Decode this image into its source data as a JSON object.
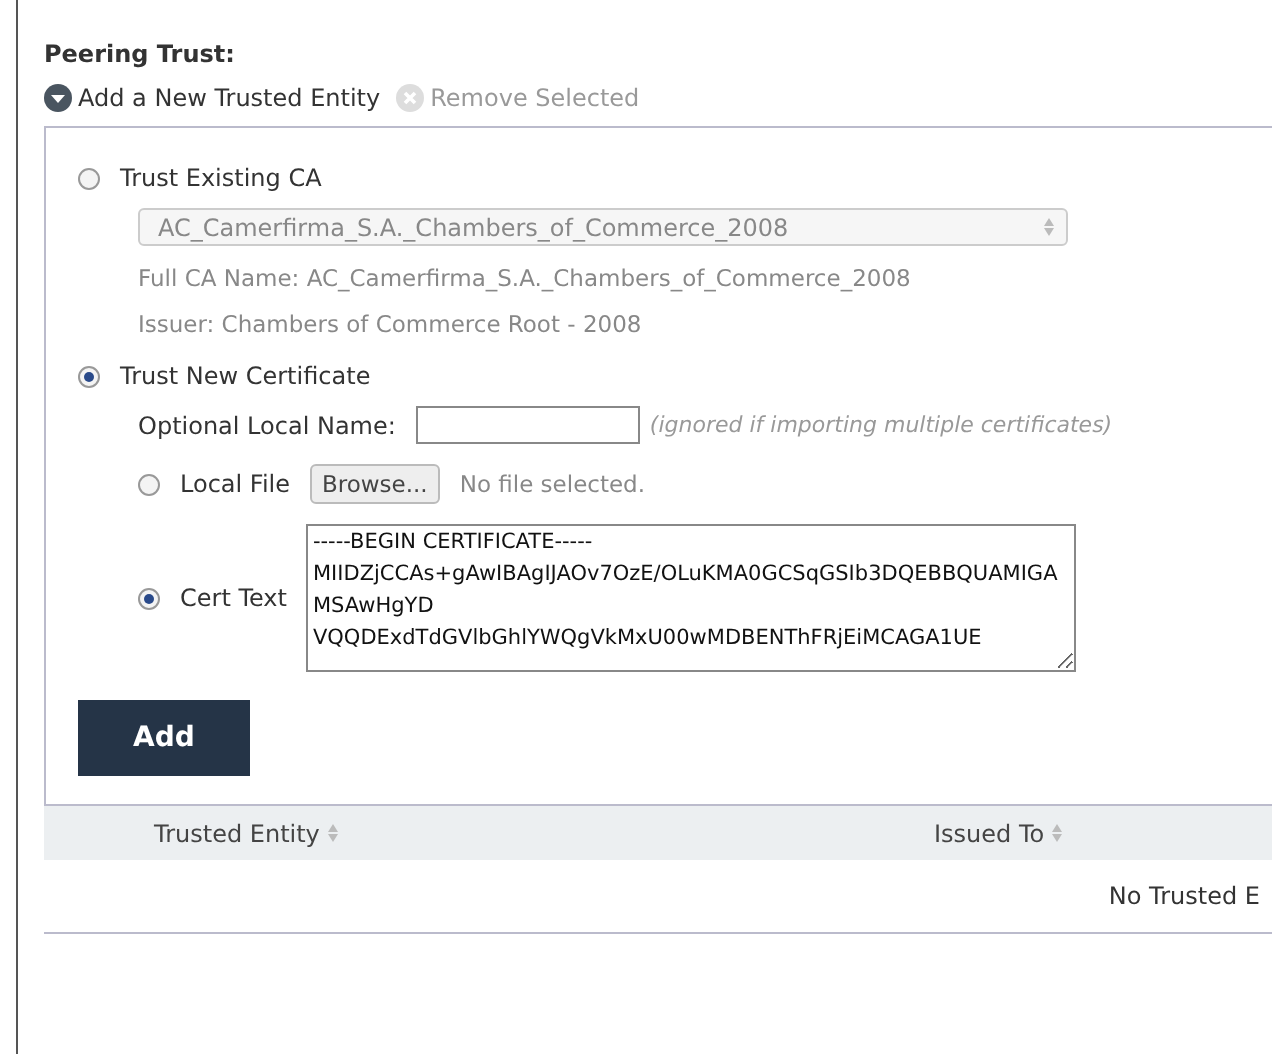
{
  "title": "Peering Trust:",
  "actions": [
    {
      "label": "Add a New Trusted Entity",
      "kind": "expand",
      "disabled": false
    },
    {
      "label": "Remove Selected",
      "kind": "remove",
      "disabled": true
    }
  ],
  "source_options": [
    {
      "label": "Trust Existing CA",
      "selected": false,
      "ca_select": "AC_Camerfirma_S.A._Chambers_of_Commerce_2008",
      "details": [
        "Full CA Name: AC_Camerfirma_S.A._Chambers_of_Commerce_2008",
        "Issuer: Chambers of Commerce Root - 2008"
      ]
    },
    {
      "label": "Trust New Certificate",
      "selected": true
    }
  ],
  "local_name": {
    "label": "Optional Local Name:",
    "hint": "(ignored if importing multiple certificates)"
  },
  "cert_options": [
    {
      "label": "Local File",
      "selected": false,
      "kind": "file",
      "button": "Browse...",
      "status": "No file selected."
    },
    {
      "label": "Cert Text",
      "selected": true,
      "kind": "text",
      "value": "-----BEGIN CERTIFICATE-----\nMIIDZjCCAs+gAwIBAgIJAOv7OzE/OLuKMA0GCSqGSIb3DQEBBQUAMIGAMSAwHgYD\nVQQDExdTdGVlbGhlYWQgVkMxU00wMDBENThFRjEiMCAGA1UE"
    }
  ],
  "add_button": "Add",
  "table": {
    "columns": [
      "Trusted Entity",
      "Issued To"
    ],
    "empty": "No Trusted E"
  }
}
